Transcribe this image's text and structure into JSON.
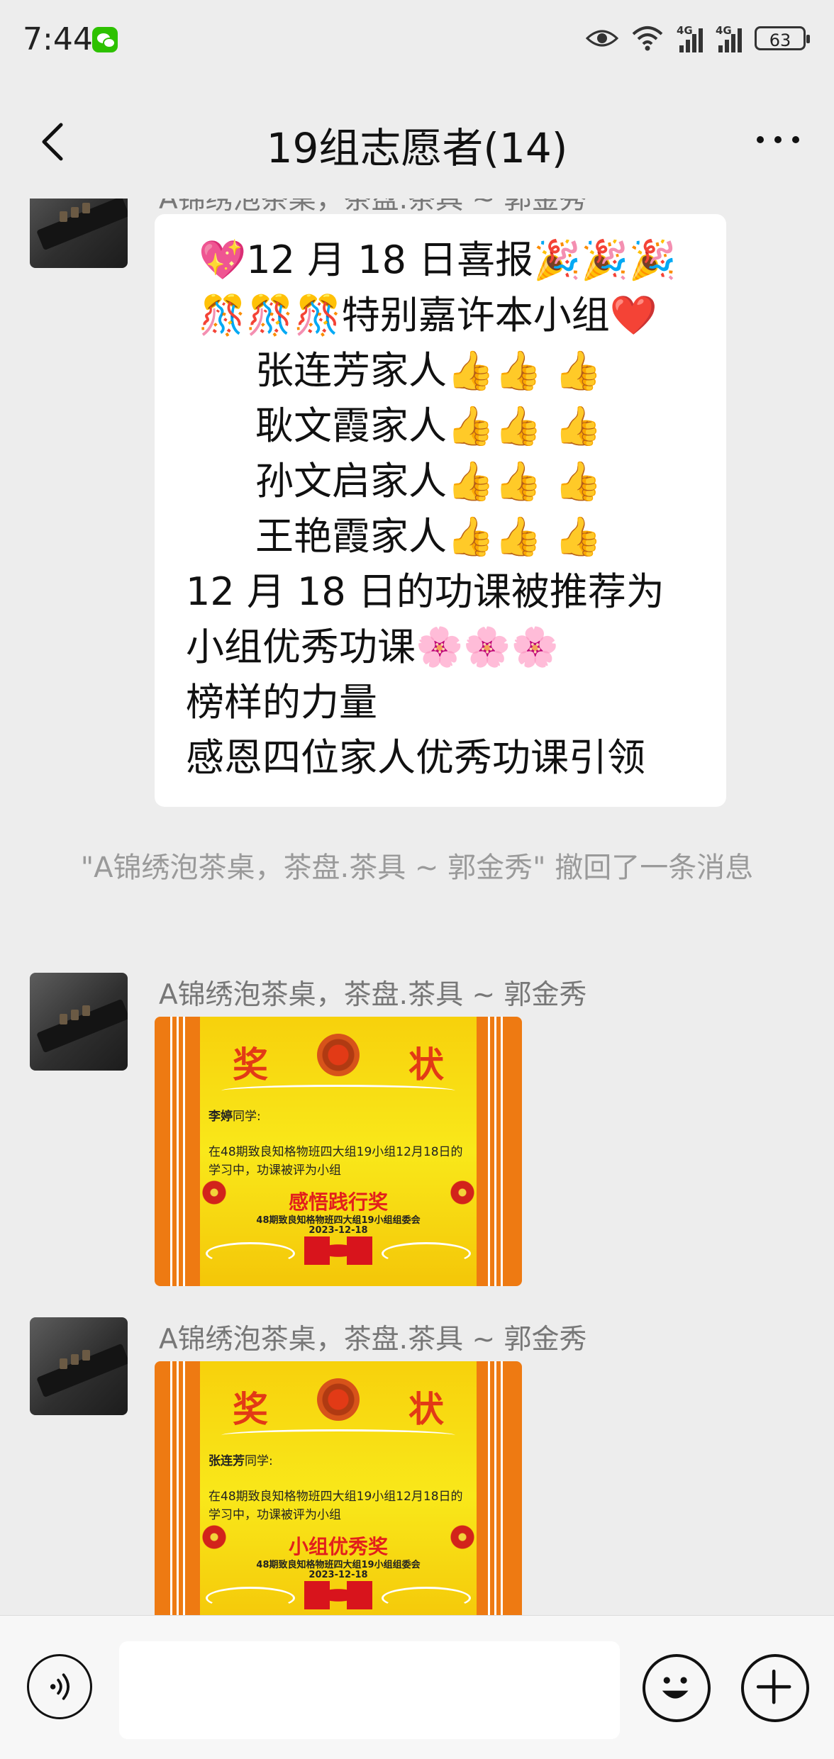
{
  "status_bar": {
    "time": "7:44",
    "network_label_1": "4G",
    "network_label_2": "4G",
    "battery": "63"
  },
  "header": {
    "title": "19组志愿者(14)"
  },
  "messages": {
    "top_partial_sender": "A锦绣泡茶桌，茶盘.茶具 ~ 郭金秀",
    "text_bubble_lines": [
      "💖12 月 18 日喜报🎉🎉🎉",
      "🎊🎊🎊特别嘉许本小组❤️",
      "张连芳家人👍👍 👍",
      "耿文霞家人👍👍 👍",
      "孙文启家人👍👍 👍",
      "王艳霞家人👍👍 👍",
      "12 月 18 日的功课被推荐为小组优秀功课🌸🌸🌸",
      "榜样的力量",
      "感恩四位家人优秀功课引领"
    ],
    "recall_notice": "\"A锦绣泡茶桌，茶盘.茶具 ~ 郭金秀\" 撤回了一条消息",
    "image_message_1": {
      "sender": "A锦绣泡茶桌，茶盘.茶具 ~ 郭金秀",
      "cert_title_left": "奖",
      "cert_title_right": "状",
      "recipient_name": "李婷",
      "recipient_suffix": "同学:",
      "body": "在48期致良知格物班四大组19小组12月18日的学习中，功课被评为小组",
      "award": "感悟践行奖",
      "org": "48期致良知格物班四大组19小组组委会",
      "date": "2023-12-18"
    },
    "image_message_2": {
      "sender": "A锦绣泡茶桌，茶盘.茶具 ~ 郭金秀",
      "cert_title_left": "奖",
      "cert_title_right": "状",
      "recipient_name": "张连芳",
      "recipient_suffix": "同学:",
      "body": "在48期致良知格物班四大组19小组12月18日的学习中，功课被评为小组",
      "award": "小组优秀奖",
      "org": "48期致良知格物班四大组19小组组委会",
      "date": "2023-12-18"
    }
  },
  "input_bar": {
    "text_value": ""
  },
  "icons": [
    "back-icon",
    "more-icon",
    "eye-icon",
    "wifi-icon",
    "voice-icon",
    "emoji-icon",
    "plus-icon"
  ]
}
